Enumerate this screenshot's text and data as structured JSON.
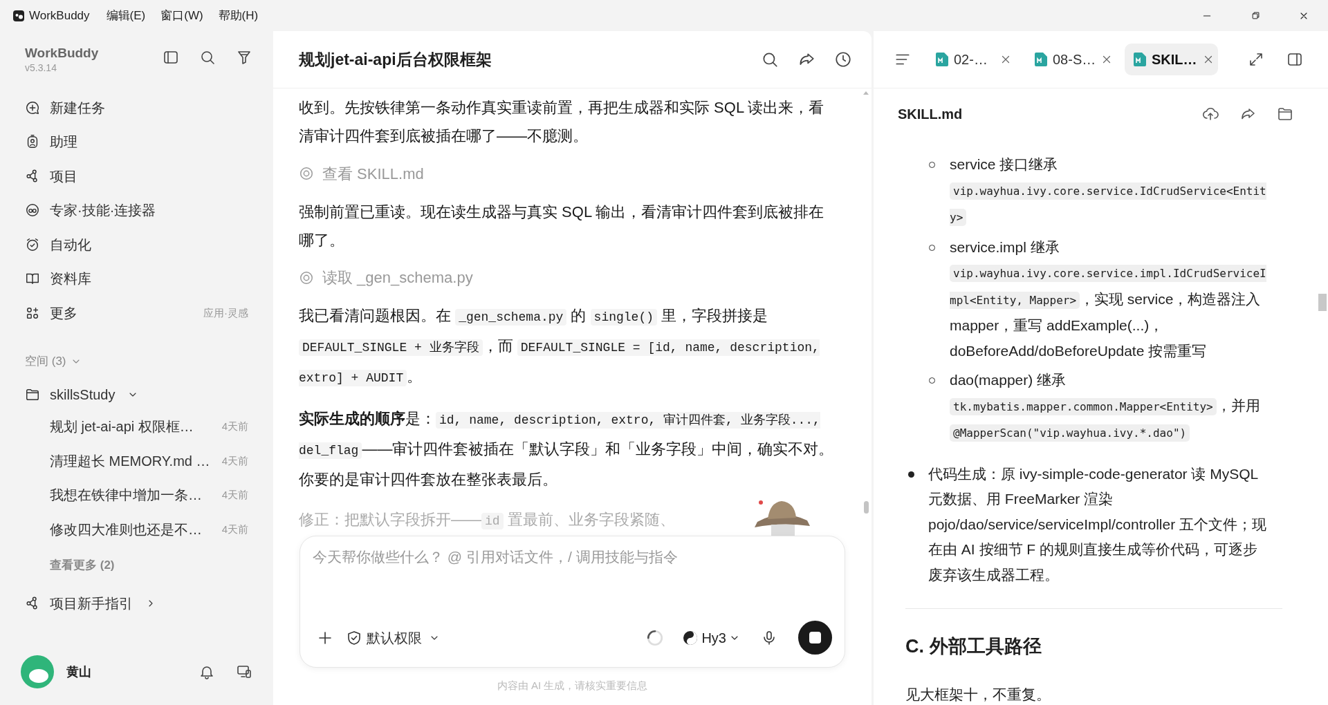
{
  "menu_bar": {
    "app_name": "WorkBuddy",
    "menus": [
      "编辑(E)",
      "窗口(W)",
      "帮助(H)"
    ]
  },
  "sidebar": {
    "app_name": "WorkBuddy",
    "version": "v5.3.14",
    "nav": [
      {
        "label": "新建任务",
        "kind": "new-task"
      },
      {
        "label": "助理",
        "kind": "assistant"
      },
      {
        "label": "项目",
        "kind": "project"
      },
      {
        "label": "专家·技能·连接器",
        "kind": "experts"
      },
      {
        "label": "自动化",
        "kind": "automation"
      },
      {
        "label": "资料库",
        "kind": "library"
      },
      {
        "label": "更多",
        "kind": "more",
        "note": "应用·灵感"
      }
    ],
    "spaces_label": "空间 (3)",
    "folder": {
      "name": "skillsStudy",
      "expanded": true
    },
    "tasks": [
      {
        "title": "规划 jet-ai-api 权限框…",
        "time": "4天前"
      },
      {
        "title": "清理超长 MEMORY.md …",
        "time": "4天前"
      },
      {
        "title": "我想在铁律中增加一条…",
        "time": "4天前"
      },
      {
        "title": "修改四大准则也还是不…",
        "time": "4天前"
      }
    ],
    "see_more": "查看更多 (2)",
    "guide": "项目新手指引",
    "user": {
      "name": "黄山"
    }
  },
  "chat": {
    "title": "规划jet-ai-api后台权限框架",
    "messages": [
      {
        "kind": "text",
        "segments": [
          {
            "text": "收到。先按铁律第一条动作真实重读前置，再把生成器和实际 SQL 读出来，看清审计四件套到底被插在哪了——不臆测。",
            "code": false
          }
        ]
      },
      {
        "kind": "tool",
        "segments": [
          {
            "text": "查看 SKILL.md",
            "code": false
          }
        ]
      },
      {
        "kind": "text",
        "segments": [
          {
            "text": "强制前置已重读。现在读生成器与真实 SQL 输出，看清审计四件套到底被排在哪了。",
            "code": false
          }
        ]
      },
      {
        "kind": "tool",
        "segments": [
          {
            "text": "读取 _gen_schema.py",
            "code": false
          }
        ]
      },
      {
        "kind": "text",
        "segments": [
          {
            "text": "我已看清问题根因。在 ",
            "code": false
          },
          {
            "text": "_gen_schema.py",
            "code": true
          },
          {
            "text": " 的 ",
            "code": false
          },
          {
            "text": "single()",
            "code": true
          },
          {
            "text": " 里，字段拼接是 ",
            "code": false
          },
          {
            "text": "DEFAULT_SINGLE + 业务字段",
            "code": true
          },
          {
            "text": "，而 ",
            "code": false
          },
          {
            "text": "DEFAULT_SINGLE = [id, name, description, extro] + AUDIT",
            "code": true
          },
          {
            "text": "。",
            "code": false
          }
        ]
      },
      {
        "kind": "text",
        "segments": [
          {
            "text": "**实际生成的顺序**是：",
            "code": false
          },
          {
            "text": "id, name, description, extro, 审计四件套, 业务字段..., del_flag",
            "code": true
          },
          {
            "text": "——审计四件套被插在「默认字段」和「业务字段」中间，确实不对。你要的是审计四件套放在整张表最后。",
            "code": false
          }
        ]
      },
      {
        "kind": "faded",
        "segments": [
          {
            "text": "修正：把默认字段拆开——",
            "code": false
          },
          {
            "text": "id",
            "code": true
          },
          {
            "text": " 置最前、业务字段紧随、",
            "code": false
          }
        ]
      }
    ],
    "composer": {
      "placeholder": "今天帮你做些什么？ @ 引用对话文件，/ 调用技能与指令",
      "permission": "默认权限",
      "model": "Hy3"
    },
    "disclaimer": "内容由 AI 生成，请核实重要信息"
  },
  "preview": {
    "tabs": [
      {
        "label": "02-…",
        "selected": false
      },
      {
        "label": "08-S…",
        "selected": false
      },
      {
        "label": "SKIL…",
        "selected": true
      }
    ],
    "document": {
      "title": "SKILL.md",
      "blocks": [
        {
          "kind": "sublist",
          "items": [
            [
              {
                "text": "service 接口继承 ",
                "code": false
              },
              {
                "text": "vip.wayhua.ivy.core.service.IdCrudService<Entity>",
                "code": true
              }
            ],
            [
              {
                "text": "service.impl 继承 ",
                "code": false
              },
              {
                "text": "vip.wayhua.ivy.core.service.impl.IdCrudServiceImpl<Entity, Mapper>",
                "code": true
              },
              {
                "text": "，实现 service，构造器注入 mapper，重写 addExample(...)，doBeforeAdd/doBeforeUpdate 按需重写",
                "code": false
              }
            ],
            [
              {
                "text": "dao(mapper) 继承 ",
                "code": false
              },
              {
                "text": "tk.mybatis.mapper.common.Mapper<Entity>",
                "code": true
              },
              {
                "text": "，并用 ",
                "code": false
              },
              {
                "text": "@MapperScan(\"vip.wayhua.ivy.*.dao\")",
                "code": true
              }
            ]
          ]
        },
        {
          "kind": "list",
          "items": [
            [
              {
                "text": "代码生成：原 ivy-simple-code-generator 读 MySQL 元数据、用 FreeMarker 渲染 pojo/dao/service/serviceImpl/controller 五个文件；现在由 AI 按细节 F 的规则直接生成等价代码，可逐步废弃该生成器工程。",
                "code": false
              }
            ]
          ]
        },
        {
          "kind": "rule"
        },
        {
          "kind": "heading",
          "text": "C. 外部工具路径"
        },
        {
          "kind": "paragraph",
          "segments": [
            {
              "text": "见大框架十，不重复。",
              "code": false
            }
          ]
        }
      ]
    }
  }
}
